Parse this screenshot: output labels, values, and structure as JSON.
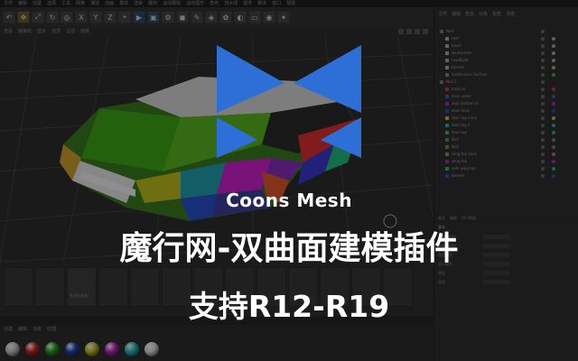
{
  "menu": [
    "文件",
    "编辑",
    "创建",
    "选择",
    "工具",
    "网格",
    "捕捉",
    "动画",
    "模拟",
    "渲染",
    "雕刻",
    "运动跟踪",
    "运动图形",
    "角色",
    "流水线",
    "插件",
    "脚本",
    "窗口",
    "帮助"
  ],
  "toolbar": {
    "axis_x": "X",
    "axis_y": "Y",
    "axis_z": "Z"
  },
  "viewport_menu": [
    "查看",
    "摄像机",
    "显示",
    "选项",
    "过滤",
    "面板"
  ],
  "objects": {
    "tabs": [
      "文件",
      "编辑",
      "查看",
      "对象",
      "标签",
      "书签"
    ],
    "items": [
      {
        "label": "Null",
        "depth": 0,
        "color": "#777"
      },
      {
        "label": "roof",
        "depth": 1,
        "color": "#aaa"
      },
      {
        "label": "hood",
        "depth": 1,
        "color": "#aaa"
      },
      {
        "label": "windscreen",
        "depth": 1,
        "color": "#aaa"
      },
      {
        "label": "headlight",
        "depth": 1,
        "color": "#aaa"
      },
      {
        "label": "bonnet",
        "depth": 1,
        "color": "#aaa"
      },
      {
        "label": "Subdivision Surface",
        "depth": 1,
        "color": "#4aa84a"
      },
      {
        "label": "Null.1",
        "depth": 0,
        "color": "#777"
      },
      {
        "label": "backcut",
        "depth": 1,
        "color": "#c04040"
      },
      {
        "label": "door under",
        "depth": 1,
        "color": "#3060c0"
      },
      {
        "label": "door bottom in",
        "depth": 1,
        "color": "#c020c0"
      },
      {
        "label": "door main",
        "depth": 1,
        "color": "#2a4ad0"
      },
      {
        "label": "door top inner",
        "depth": 1,
        "color": "#c0c020"
      },
      {
        "label": "door top.1",
        "depth": 1,
        "color": "#20b0b0"
      },
      {
        "label": "door top",
        "depth": 1,
        "color": "#30c030"
      },
      {
        "label": "Null",
        "depth": 1,
        "color": "#777"
      },
      {
        "label": "Null",
        "depth": 1,
        "color": "#777"
      },
      {
        "label": "wing top back",
        "depth": 1,
        "color": "#c08020"
      },
      {
        "label": "wing top",
        "depth": 1,
        "color": "#a030c0"
      },
      {
        "label": "side wing top",
        "depth": 1,
        "color": "#20c060"
      },
      {
        "label": "bonnet",
        "depth": 1,
        "color": "#3050c0"
      }
    ]
  },
  "attributes": {
    "tabs": [
      "模式",
      "编辑",
      "用户数据"
    ],
    "section": "基本",
    "rows": [
      "编辑器可见",
      "渲染器可见",
      "使用颜色",
      "显示颜色",
      "透显",
      "启用"
    ]
  },
  "timeline": {
    "item_label": "多边形画笔"
  },
  "material_menu": [
    "创建",
    "编辑",
    "功能",
    "纹理"
  ],
  "material_colors": [
    "#c8c8c8",
    "#d02020",
    "#20a020",
    "#2040c0",
    "#c0c020",
    "#c020c0",
    "#20c0c0",
    "#e0e0e0"
  ],
  "overlay": {
    "brand": "Coons Mesh",
    "headline": "魔行网-双曲面建模插件",
    "support": "支持R12-R19",
    "logo_color": "#2d6fd6"
  }
}
